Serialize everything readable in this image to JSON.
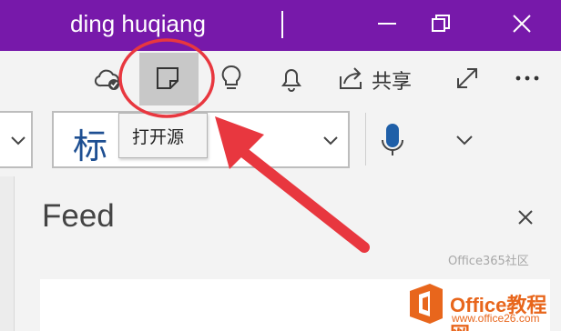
{
  "titlebar": {
    "user_name": "ding huqiang",
    "background": "#7719aa",
    "buttons": [
      "minimize-icon",
      "restore-icon",
      "close-icon"
    ]
  },
  "toolbar": {
    "icons": [
      "cloud-sync-check-icon",
      "open-source-icon",
      "lightbulb-icon",
      "bell-icon",
      "share-icon",
      "expand-icon",
      "more-icon"
    ],
    "share_label": "共享"
  },
  "ribbon": {
    "style_value": "标",
    "icons": [
      "chevron-down-icon",
      "microphone-icon",
      "chevron-down-icon"
    ]
  },
  "tooltip": {
    "text": "打开源"
  },
  "feed": {
    "title": "Feed",
    "close_icon": "close-icon"
  },
  "annotations": {
    "highlight_circle_color": "#e8373f",
    "arrow_color": "#e8373f"
  },
  "watermark": {
    "sub": "Office365社区",
    "title": "Office教程网",
    "url": "www.office26.com",
    "logo_color": "#e8661c"
  }
}
